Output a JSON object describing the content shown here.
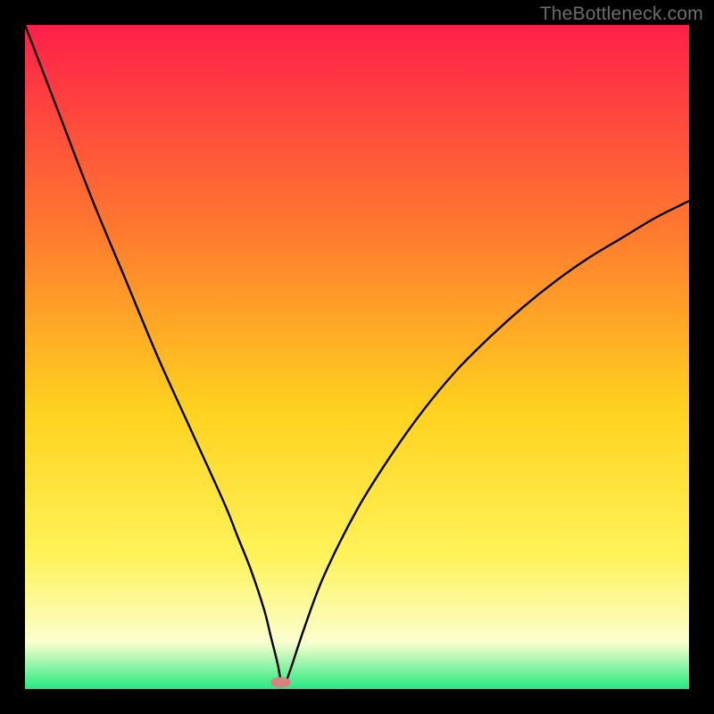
{
  "watermark": "TheBottleneck.com",
  "colors": {
    "frame_bg": "#000000",
    "gradient_top": "#ff1f4a",
    "gradient_mid_upper": "#ff7d2e",
    "gradient_mid": "#ffd21f",
    "gradient_mid_lower": "#fff35a",
    "gradient_pale": "#fbffcf",
    "gradient_bottom": "#25e981",
    "curve_stroke": "#000000",
    "marker_fill": "#d98080"
  },
  "chart_data": {
    "type": "line",
    "title": "",
    "xlabel": "",
    "ylabel": "",
    "xlim": [
      0,
      100
    ],
    "ylim": [
      0,
      100
    ],
    "x": [
      0,
      5,
      10,
      15,
      20,
      25,
      30,
      32,
      34,
      36,
      37,
      38,
      38.5,
      39,
      40,
      42,
      45,
      50,
      55,
      60,
      65,
      70,
      75,
      80,
      85,
      90,
      95,
      100
    ],
    "values": [
      100,
      87,
      74,
      62,
      50,
      39,
      28,
      23,
      18,
      12,
      8,
      4,
      1.5,
      0.5,
      3,
      9,
      17,
      27,
      35,
      42,
      48,
      53,
      57.5,
      61.5,
      65,
      68,
      71,
      73.5
    ],
    "marker": {
      "x": 38.5,
      "y": 1.0,
      "rx": 1.5,
      "ry": 0.8
    },
    "annotations": []
  }
}
